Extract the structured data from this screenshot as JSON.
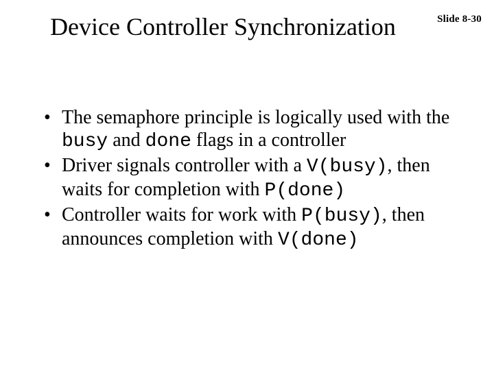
{
  "slide_number": "Slide 8-30",
  "title": "Device Controller Synchronization",
  "bullets": {
    "b1": {
      "t1": "The semaphore principle is logically used with the ",
      "code1": "busy",
      "t2": " and ",
      "code2": "done",
      "t3": " flags in a controller"
    },
    "b2": {
      "t1": "Driver signals controller with a ",
      "code1": "V(busy)",
      "t2": ", then waits for completion with ",
      "code2": "P(done)"
    },
    "b3": {
      "t1": "Controller waits for work with ",
      "code1": "P(busy)",
      "t2": ", then announces completion with ",
      "code2": "V(done)"
    }
  }
}
